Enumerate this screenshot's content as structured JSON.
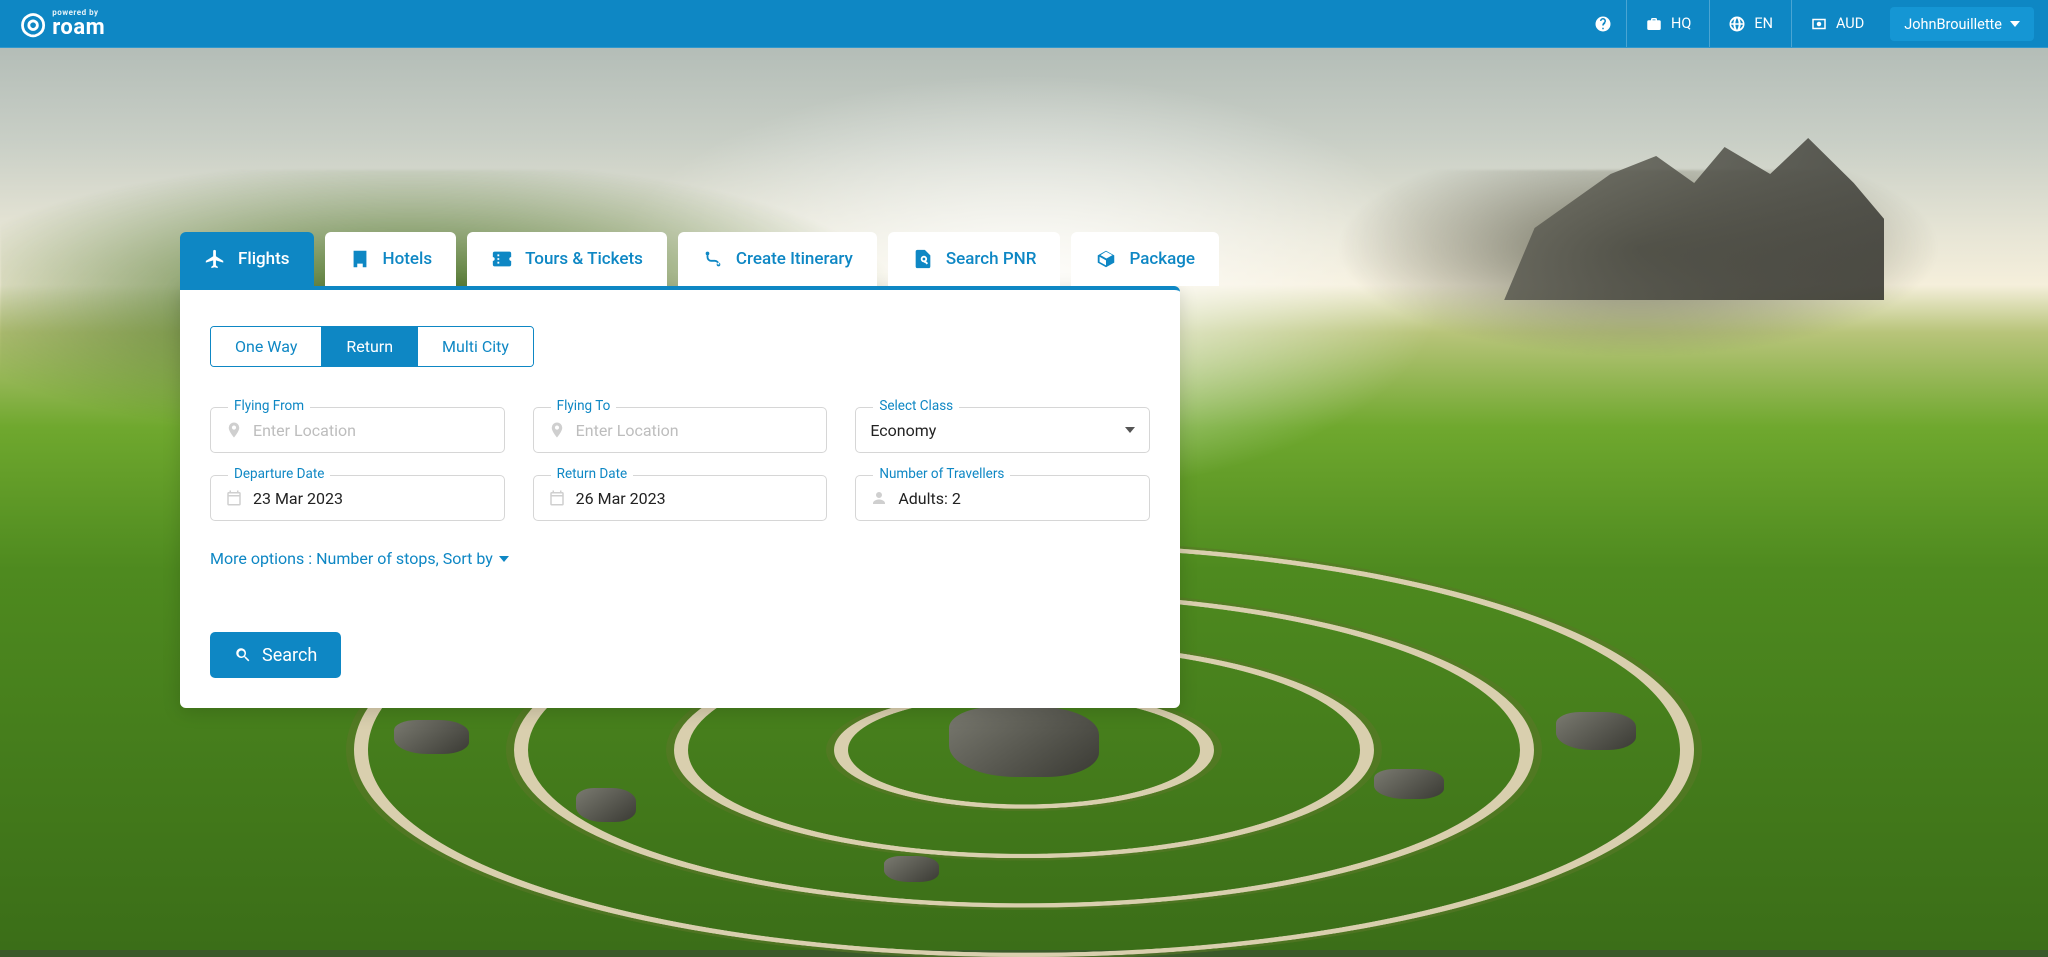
{
  "brand": {
    "powered_by": "powered by",
    "name": "roam"
  },
  "header": {
    "hq": "HQ",
    "lang": "EN",
    "currency": "AUD",
    "user": "JohnBrouillette"
  },
  "tabs": {
    "flights": "Flights",
    "hotels": "Hotels",
    "tours": "Tours & Tickets",
    "itinerary": "Create Itinerary",
    "pnr": "Search PNR",
    "package": "Package"
  },
  "trip_type": {
    "one_way": "One Way",
    "return": "Return",
    "multi": "Multi City"
  },
  "fields": {
    "from_label": "Flying From",
    "from_placeholder": "Enter Location",
    "to_label": "Flying To",
    "to_placeholder": "Enter Location",
    "class_label": "Select Class",
    "class_value": "Economy",
    "dep_label": "Departure Date",
    "dep_value": "23 Mar 2023",
    "ret_label": "Return Date",
    "ret_value": "26 Mar 2023",
    "trav_label": "Number of Travellers",
    "trav_value": "Adults: 2"
  },
  "more_options": "More options : Number of stops, Sort by",
  "search_label": "Search"
}
